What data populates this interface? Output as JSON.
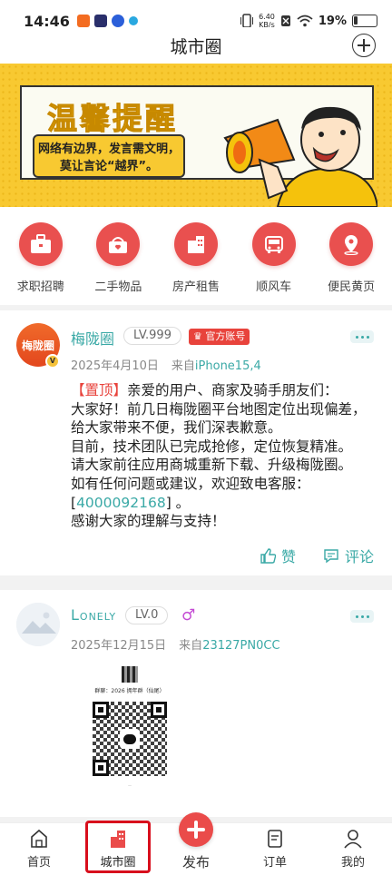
{
  "status_bar": {
    "time": "14:46",
    "net_speed_value": "6.40",
    "net_speed_unit": "KB/s",
    "battery": "19%"
  },
  "header": {
    "title": "城市圈"
  },
  "banner": {
    "headline": "温馨提醒",
    "line1": "网络有边界，发言需文明，",
    "line2": "莫让言论“越界”。"
  },
  "categories": [
    {
      "label": "求职招聘",
      "icon": "briefcase-icon"
    },
    {
      "label": "二手物品",
      "icon": "basket-icon"
    },
    {
      "label": "房产租售",
      "icon": "building-icon"
    },
    {
      "label": "顺风车",
      "icon": "car-icon"
    },
    {
      "label": "便民黄页",
      "icon": "location-pin-icon"
    }
  ],
  "posts": [
    {
      "avatar_text": "梅陇圈",
      "username": "梅陇圈",
      "level": "LV.999",
      "official_badge": "官方账号",
      "date": "2025年4月10日",
      "source_prefix": "来自",
      "device": "iPhone15,4",
      "tag": "【置顶】",
      "line1": "亲爱的用户、商家及骑手朋友们：",
      "line2": "大家好！前几日梅陇圈平台地图定位出现偏差，",
      "line3": "给大家带来不便，我们深表歉意。",
      "line4": "目前，技术团队已完成抢修，定位恢复精准。",
      "line5": "请大家前往应用商城重新下载、升级梅陇圈。",
      "line6": "如有任何问题或建议，欢迎致电客服：",
      "phone_open": "[",
      "phone": "4000092168",
      "phone_close": "] 。",
      "line7": "感谢大家的理解与支持！",
      "like_label": "赞",
      "comment_label": "评论"
    },
    {
      "username": "Lonely",
      "level": "LV.0",
      "date": "2025年12月15日",
      "source_prefix": "来自",
      "device": "23127PN0CC",
      "qr_caption": "群聊：2026 拥年群（仙尾）"
    }
  ],
  "tabbar": {
    "home": "首页",
    "city": "城市圈",
    "publish": "发布",
    "orders": "订单",
    "mine": "我的"
  },
  "colors": {
    "accent_teal": "#3aa9a6",
    "brand_red": "#e9504f",
    "highlight_box": "#d80e1c",
    "banner_yellow": "#f8c931"
  }
}
